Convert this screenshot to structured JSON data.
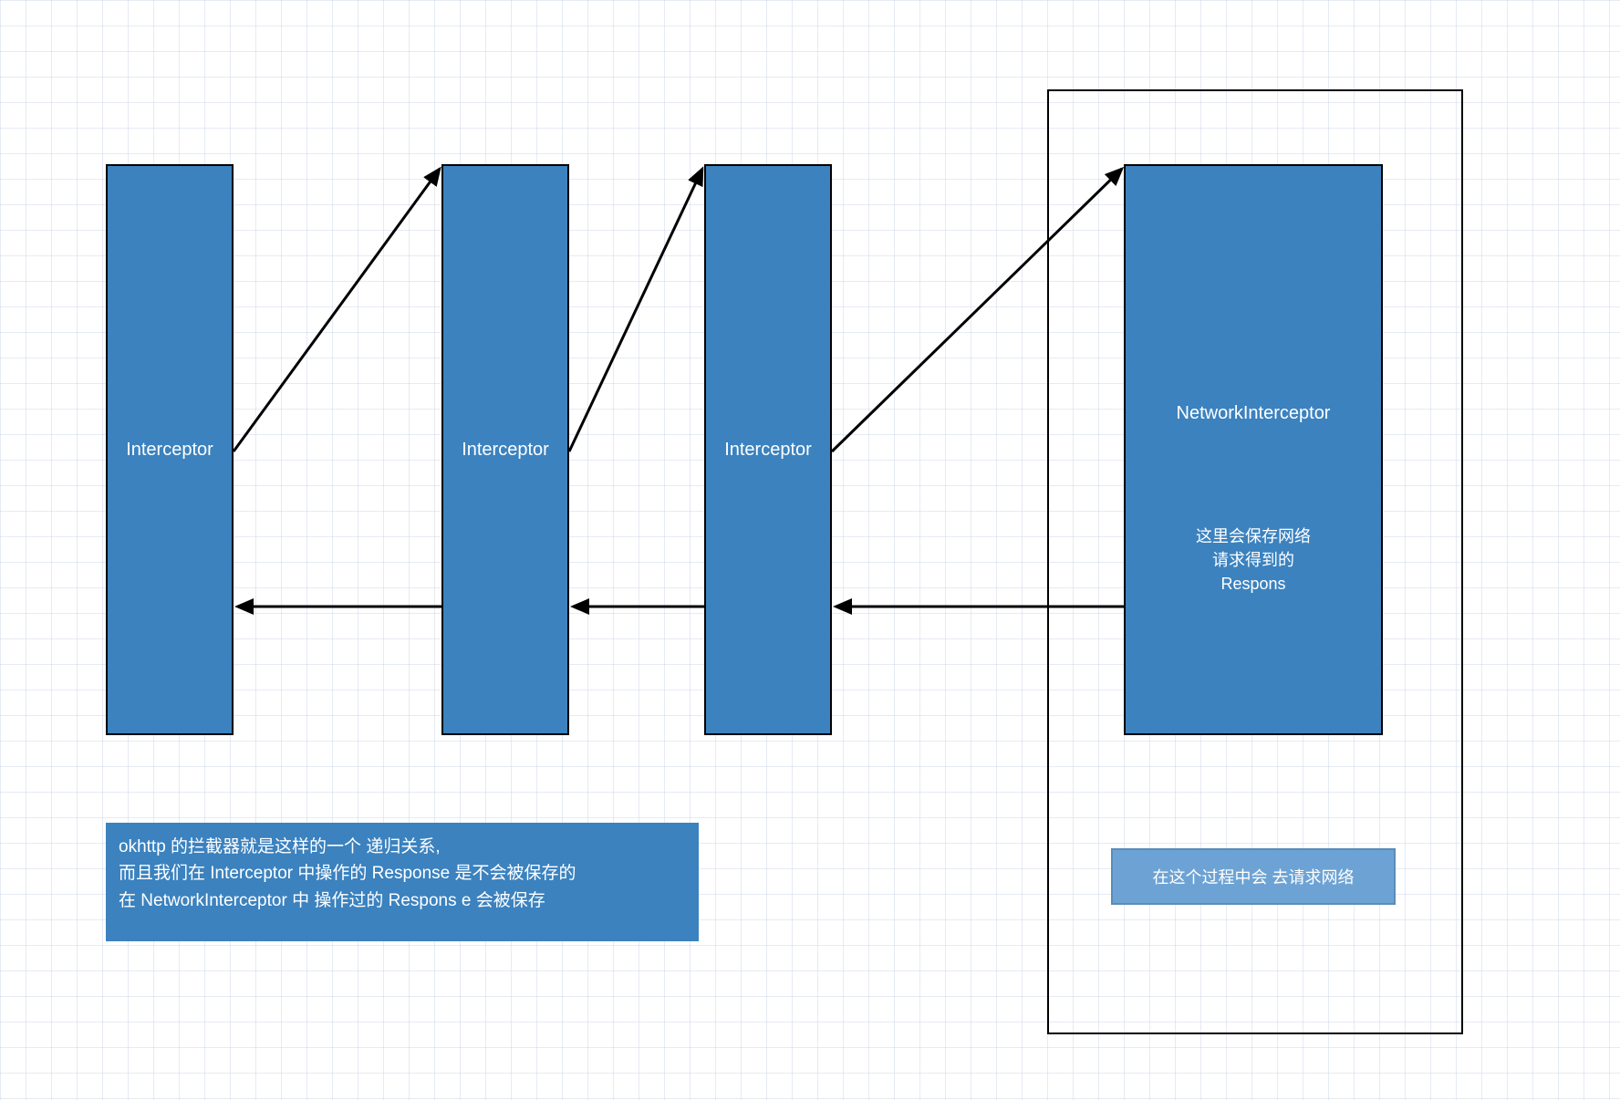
{
  "boxes": {
    "interceptor1": "Interceptor",
    "interceptor2": "Interceptor",
    "interceptor3": "Interceptor",
    "networkInterceptor": {
      "title": "NetworkInterceptor",
      "subtitle_line1": "这里会保存网络",
      "subtitle_line2": "请求得到的",
      "subtitle_line3": "Respons"
    }
  },
  "notes": {
    "main_line1": "okhttp 的拦截器就是这样的一个 递归关系,",
    "main_line2": "而且我们在 Interceptor 中操作的 Response 是不会被保存的",
    "main_line3": "在 NetworkInterceptor 中 操作过的 Respons e 会被保存",
    "small": "在这个过程中会 去请求网络"
  }
}
